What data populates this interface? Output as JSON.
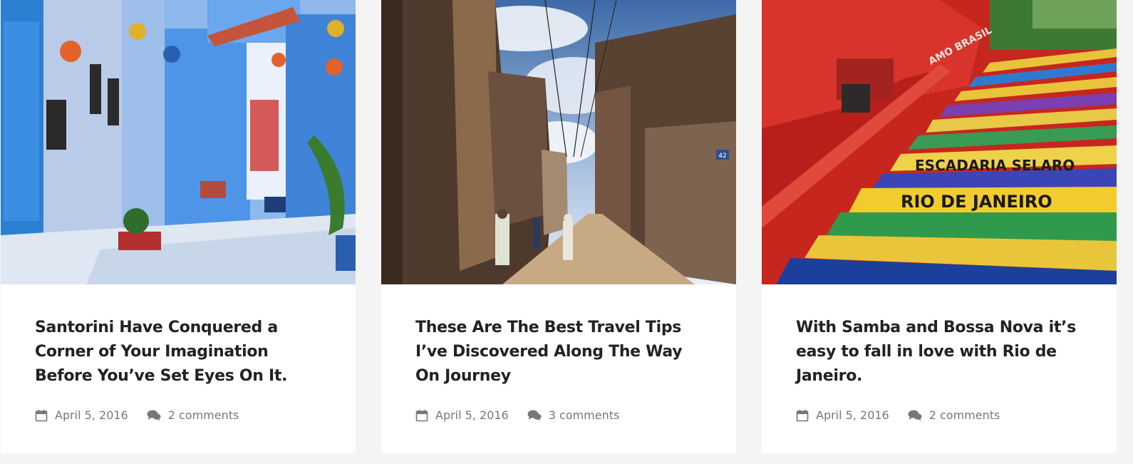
{
  "posts": [
    {
      "image_alt": "Blue painted alley with potted plants",
      "title": "Santorini Have Conquered a Corner of Your Imagination Before You’ve Set Eyes On It.",
      "date": "April 5, 2016",
      "comments": "2 comments"
    },
    {
      "image_alt": "Old brick street with people walking",
      "title": "These Are The Best Travel Tips I’ve Discovered Along The Way On Journey",
      "date": "April 5, 2016",
      "comments": "3 comments"
    },
    {
      "image_alt": "Colorful tiled staircase",
      "title": "With Samba and Bossa Nova it’s easy to fall in love with Rio de Janeiro.",
      "date": "April 5, 2016",
      "comments": "2 comments"
    }
  ],
  "signs": {
    "stairs_line1": "ESCADARIA SELARO",
    "stairs_line2": "RIO DE JANEIRO",
    "house_number": "42",
    "wall_graffiti": "AMO BRASIL"
  },
  "icons": {
    "date": "calendar-icon",
    "comments": "speech-bubble-icon"
  },
  "colors": {
    "card_background": "#ffffff",
    "page_background": "#f4f4f4",
    "title": "#222222",
    "meta": "#777777"
  }
}
